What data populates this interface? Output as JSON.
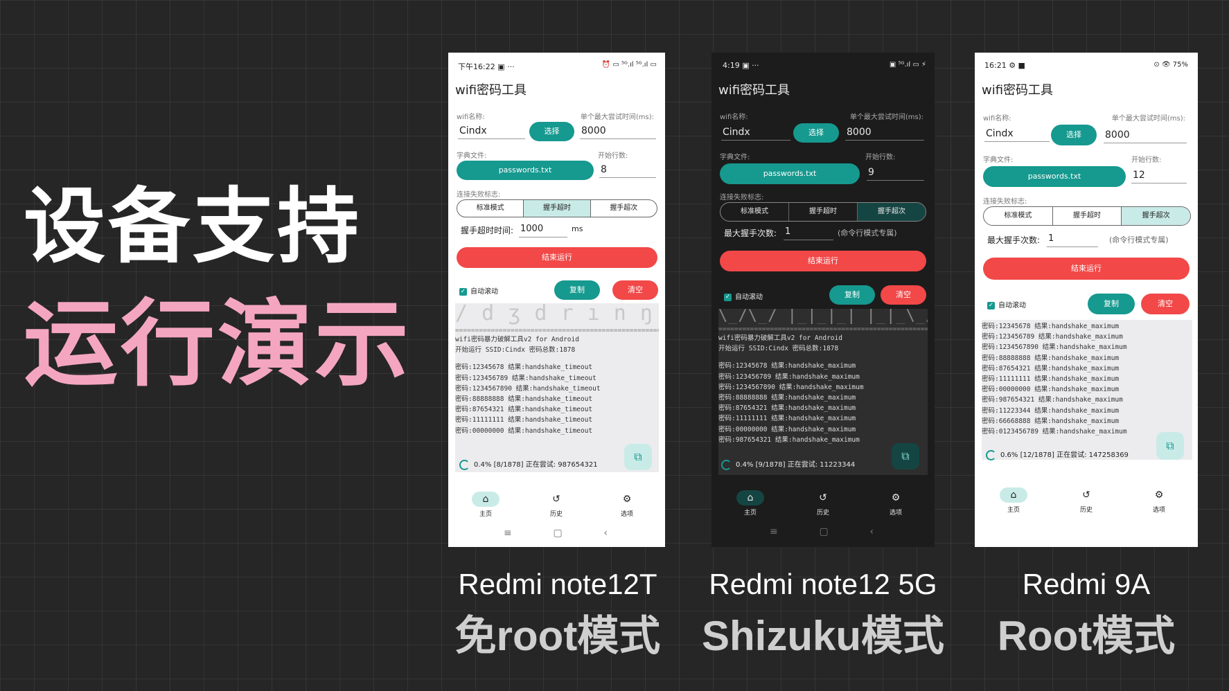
{
  "headline": {
    "line1": "设备支持",
    "line2": "运行演示"
  },
  "app_title": "wifi密码工具",
  "labels": {
    "wifi_name": "wifi名称:",
    "max_time": "单个最大尝试时间(ms):",
    "dict_file": "字典文件:",
    "start_line": "开始行数:",
    "fail_flag": "连接失败标志:",
    "handshake_timeout_time": "握手超时时间:",
    "max_handshake_count": "最大握手次数:",
    "cmd_only": "(命令行模式专属)",
    "ms": "ms",
    "select_btn": "选择",
    "dict_btn": "passwords.txt",
    "stop_btn": "结束运行",
    "auto_scroll": "自动滚动",
    "copy_btn": "复制",
    "clear_btn": "清空",
    "seg_standard": "标准模式",
    "seg_timeout": "握手超时",
    "seg_count": "握手超次",
    "nav_home": "主页",
    "nav_history": "历史",
    "nav_options": "选项"
  },
  "phone1": {
    "status_left": "下午16:22 ▣ ···",
    "status_right": "⏰ ▭ ⁵ᴳ.ıl ⁵ᴳ.ıl ▭",
    "wifi_name": "Cindx",
    "max_time": "8000",
    "start_line": "8",
    "timeout_value": "1000",
    "selected_mode": "握手超时",
    "ascii": "/ d ʒ d r ı n ŋ / ɡ \\",
    "sep": "============================================================",
    "header1": "wifi密码暴力破解工具v2 for Android",
    "header2": "开始运行 SSID:Cindx 密码总数:1878",
    "log": [
      "密码:12345678  结果:handshake_timeout",
      "密码:123456789  结果:handshake_timeout",
      "密码:1234567890  结果:handshake_timeout",
      "密码:88888888  结果:handshake_timeout",
      "密码:87654321  结果:handshake_timeout",
      "密码:11111111  结果:handshake_timeout",
      "密码:00000000  结果:handshake_timeout"
    ],
    "progress": "0.4% [8/1878] 正在尝试: 987654321",
    "progress_frac": 0.004
  },
  "phone2": {
    "status_left": "4:19 ▣ ···",
    "status_right": "▣ ⁵ᴳ.ıl ▭ ⚡",
    "wifi_name": "Cindx",
    "max_time": "8000",
    "start_line": "9",
    "max_count": "1",
    "selected_mode": "握手超次",
    "ascii": "\\_/\\_/ |_|_|_| |_|_\\_/  |__/ \\__/",
    "sep": "============================================================",
    "header1": "wifi密码暴力破解工具v2 for Android",
    "header2": "开始运行 SSID:Cindx 密码总数:1878",
    "log": [
      "密码:12345678  结果:handshake_maximum",
      "密码:123456789  结果:handshake_maximum",
      "密码:1234567890  结果:handshake_maximum",
      "密码:88888888  结果:handshake_maximum",
      "密码:87654321  结果:handshake_maximum",
      "密码:11111111  结果:handshake_maximum",
      "密码:00000000  结果:handshake_maximum",
      "密码:987654321  结果:handshake_maximum"
    ],
    "progress": "0.4% [9/1878] 正在尝试: 11223344",
    "progress_frac": 0.004
  },
  "phone3": {
    "status_left": "16:21 ⚙ ■",
    "status_right": "⊙ 👁 75%",
    "wifi_name": "Cindx",
    "max_time": "8000",
    "start_line": "12",
    "max_count": "1",
    "selected_mode": "握手超次",
    "log": [
      "密码:12345678  结果:handshake_maximum",
      "密码:123456789  结果:handshake_maximum",
      "密码:1234567890  结果:handshake_maximum",
      "密码:88888888  结果:handshake_maximum",
      "密码:87654321  结果:handshake_maximum",
      "密码:11111111  结果:handshake_maximum",
      "密码:00000000  结果:handshake_maximum",
      "密码:987654321  结果:handshake_maximum",
      "密码:11223344  结果:handshake_maximum",
      "密码:66668888  结果:handshake_maximum",
      "密码:0123456789  结果:handshake_maximum"
    ],
    "progress": "0.6% [12/1878] 正在尝试: 147258369",
    "progress_frac": 0.006
  },
  "captions": [
    {
      "device": "Redmi note12T",
      "mode": "免root模式"
    },
    {
      "device": "Redmi note12 5G",
      "mode": "Shizuku模式"
    },
    {
      "device": "Redmi 9A",
      "mode": "Root模式"
    }
  ],
  "icons": {
    "home": "⌂",
    "history": "↺",
    "options": "⚙",
    "fab": "⧉",
    "sys_menu": "≡",
    "sys_home": "▢",
    "sys_back": "‹",
    "check": "✓"
  },
  "colors": {
    "teal": "#16998f",
    "red": "#f24848",
    "pink": "#f4a6c0"
  }
}
